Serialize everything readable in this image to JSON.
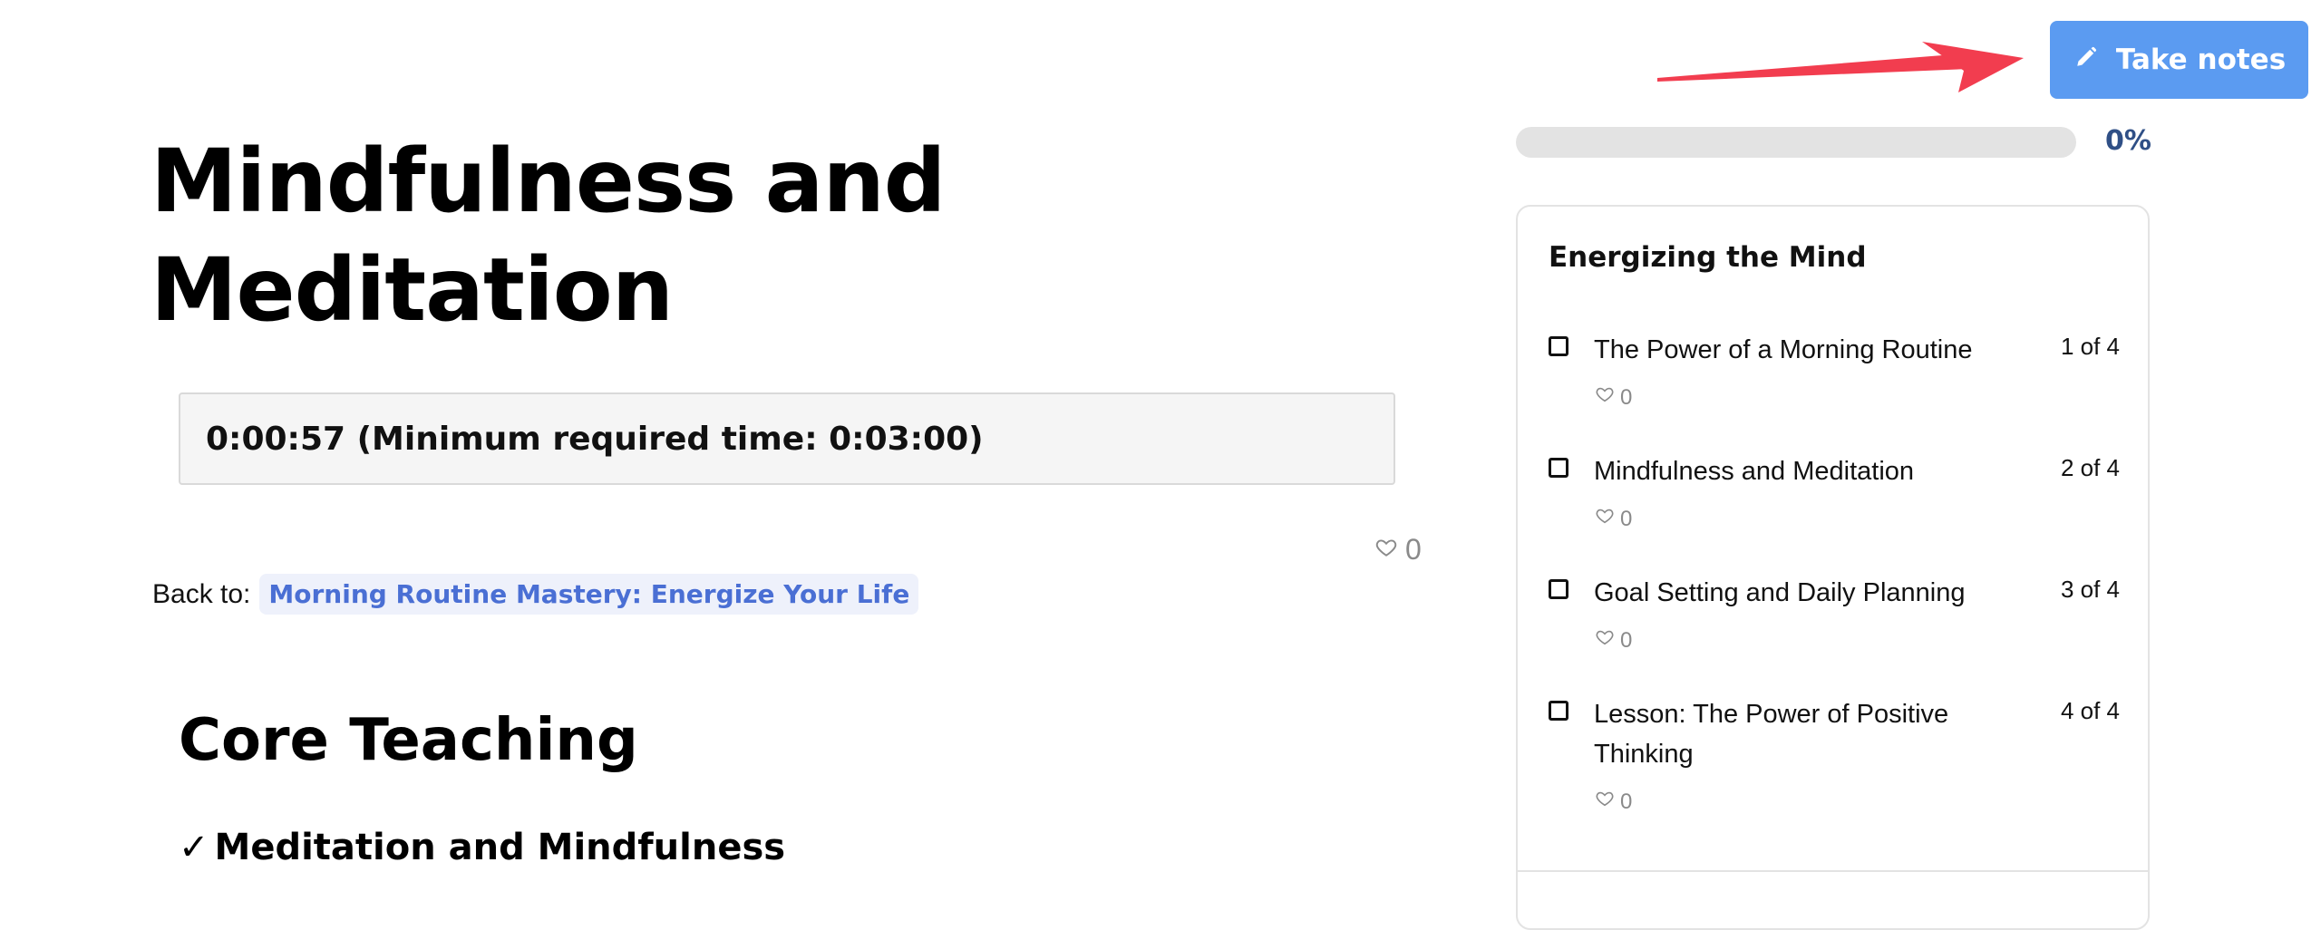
{
  "header": {
    "take_notes_label": "Take notes",
    "accent_color": "#5b9bf1",
    "annotation_arrow_color": "#f23d4f"
  },
  "main": {
    "title": "Mindfulness and Meditation",
    "timer_text": "0:00:57 (Minimum required time: 0:03:00)",
    "like_count": "0",
    "back_label": "Back to:",
    "back_link": "Morning Routine Mastery: Energize Your Life",
    "section_title": "Core Teaching",
    "subsection_check": "✓",
    "subsection_title": "Meditation and Mindfulness"
  },
  "progress": {
    "value_fraction": 0,
    "percent_label": "0%"
  },
  "sidebar": {
    "title": "Energizing the Mind",
    "lessons": [
      {
        "title": "The Power of a Morning Routine",
        "count": "1 of 4",
        "likes": "0",
        "checked": false
      },
      {
        "title": "Mindfulness and Meditation",
        "count": "2 of 4",
        "likes": "0",
        "checked": false
      },
      {
        "title": "Goal Setting and Daily Planning",
        "count": "3 of 4",
        "likes": "0",
        "checked": false
      },
      {
        "title": "Lesson: The Power of Positive Thinking",
        "count": "4 of 4",
        "likes": "0",
        "checked": false
      }
    ]
  }
}
